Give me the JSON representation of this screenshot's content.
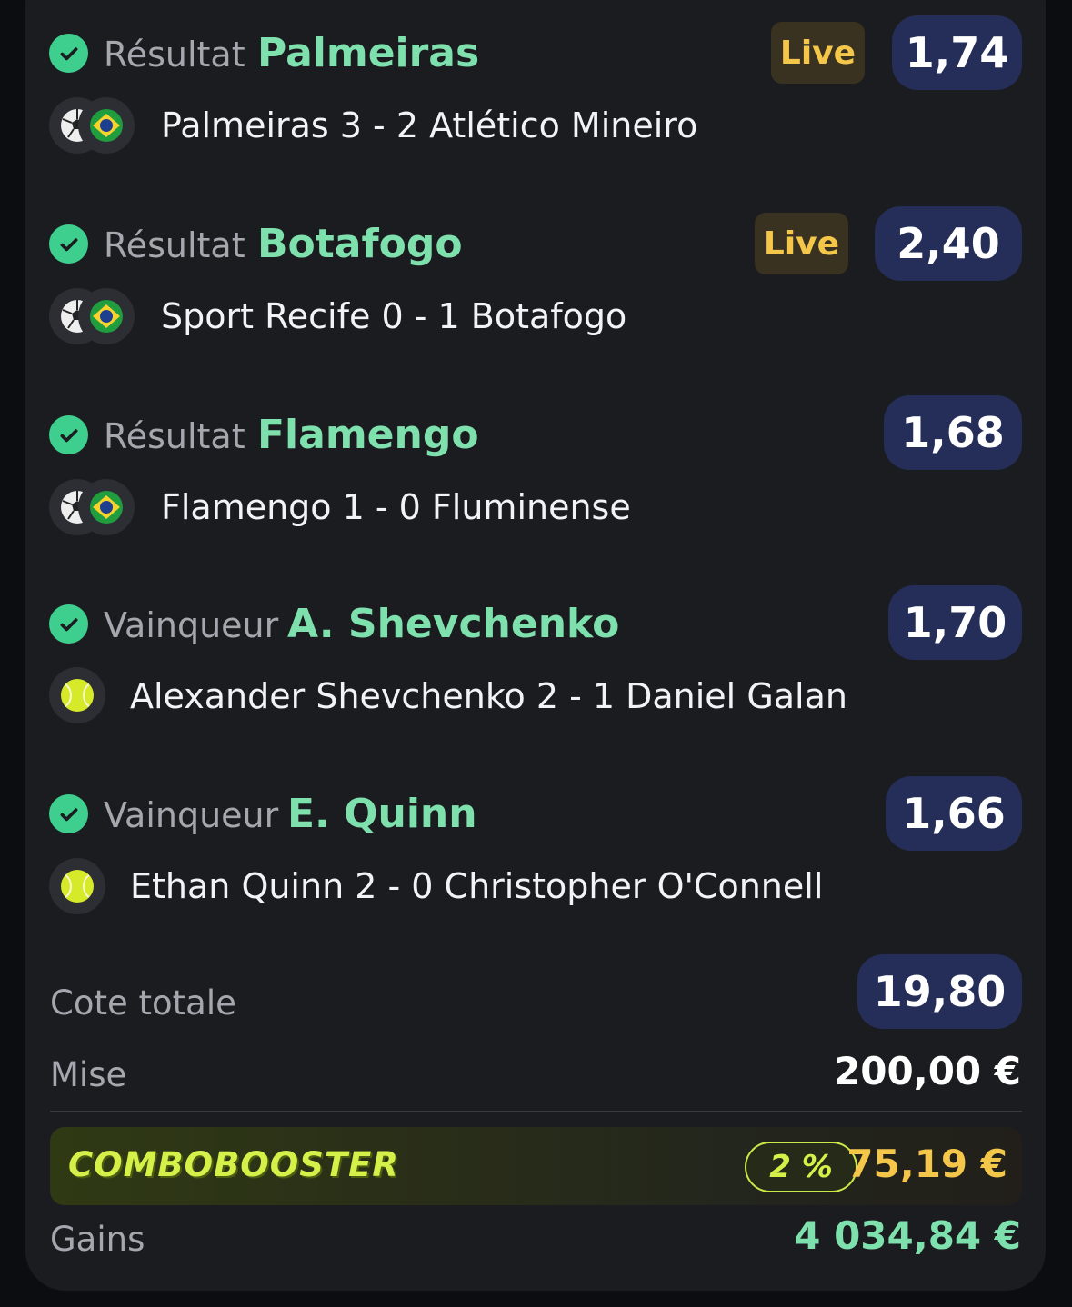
{
  "selections": [
    {
      "market": "Résultat",
      "pick": "Palmeiras",
      "live": "Live",
      "odds": "1,74",
      "sport": "football",
      "event": "Palmeiras 3 - 2 Atlético Mineiro"
    },
    {
      "market": "Résultat",
      "pick": "Botafogo",
      "live": "Live",
      "odds": "2,40",
      "sport": "football",
      "event": "Sport Recife 0 - 1 Botafogo"
    },
    {
      "market": "Résultat",
      "pick": "Flamengo",
      "live": "",
      "odds": "1,68",
      "sport": "football",
      "event": "Flamengo 1 - 0 Fluminense"
    },
    {
      "market": "Vainqueur",
      "pick": "A. Shevchenko",
      "live": "",
      "odds": "1,70",
      "sport": "tennis",
      "event": "Alexander Shevchenko 2 - 1 Daniel Galan"
    },
    {
      "market": "Vainqueur",
      "pick": "E. Quinn",
      "live": "",
      "odds": "1,66",
      "sport": "tennis",
      "event": "Ethan Quinn 2 - 0 Christopher O'Connell"
    }
  ],
  "summary": {
    "total_odds_label": "Cote totale",
    "total_odds": "19,80",
    "stake_label": "Mise",
    "stake": "200,00 €",
    "booster_logo": "COMBOBOOSTER",
    "booster_pct": "2 %",
    "booster_amount": "75,19 €",
    "gains_label": "Gains",
    "gains": "4 034,84 €"
  },
  "colors": {
    "accent_green": "#7ee0ac",
    "check_green": "#3ecf8e",
    "live_yellow": "#f4c64a",
    "odds_bg": "#252e58",
    "card_bg": "#1b1c20"
  },
  "icons": {
    "check": "check-circle-icon",
    "football": "soccer-ball-icon",
    "flag": "brazil-flag-icon",
    "tennis": "tennis-ball-icon"
  }
}
